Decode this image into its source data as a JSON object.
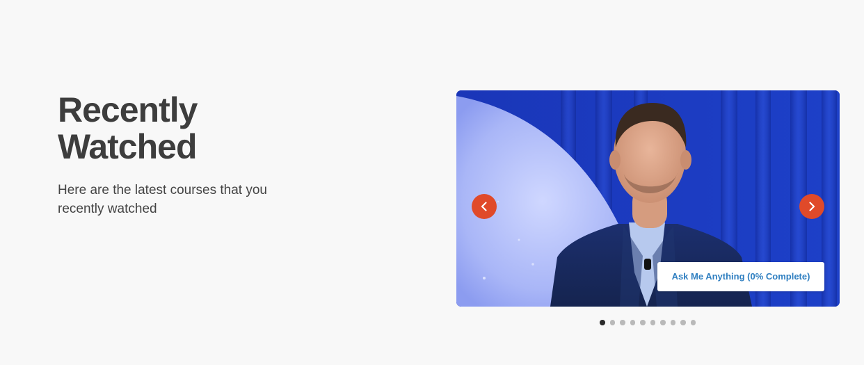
{
  "section": {
    "title": "Recently Watched",
    "subtitle": "Here are the latest courses that you recently watched"
  },
  "carousel": {
    "current_course": "Ask Me Anything (0% Complete)",
    "slide_count": 10,
    "active_index": 0,
    "prev_icon": "chevron-left-icon",
    "next_icon": "chevron-right-icon"
  },
  "colors": {
    "background": "#f8f8f8",
    "heading": "#3d3d3d",
    "arrow": "#e04a2a",
    "badge_text": "#2f7fc1",
    "dot_active": "#2a2a2a",
    "dot_inactive": "#b9b9b9"
  }
}
